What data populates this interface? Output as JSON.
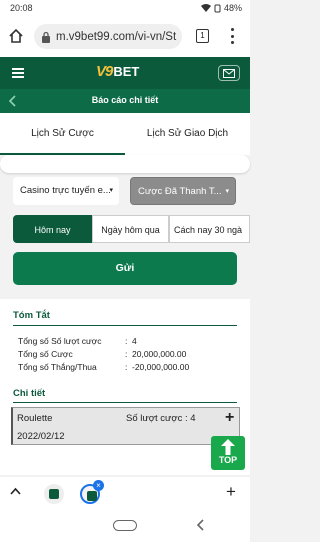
{
  "status": {
    "time": "20:08",
    "battery": "48%"
  },
  "browser": {
    "url": "m.v9bet99.com/vi-vn/St",
    "tab_count": "1"
  },
  "app": {
    "logo_v9": "V9",
    "logo_bet": "BET",
    "page_title": "Báo cáo chi tiết"
  },
  "tabs": [
    {
      "label": "Lịch Sử Cược"
    },
    {
      "label": "Lịch Sử Giao Dịch"
    }
  ],
  "filters": {
    "product": "Casino trực tuyến e...",
    "status": "Cược Đã Thanh T..."
  },
  "periods": [
    {
      "label": "Hôm nay"
    },
    {
      "label": "Ngày hôm qua"
    },
    {
      "label": "Cách nay 30 ngà"
    }
  ],
  "submit_label": "Gửi",
  "summary": {
    "title": "Tóm Tắt",
    "rows": [
      {
        "label": "Tổng số Số lượt cược",
        "value": "4"
      },
      {
        "label": "Tổng số Cược",
        "value": "20,000,000.00"
      },
      {
        "label": "Tổng số Thắng/Thua",
        "value": "-20,000,000.00"
      }
    ]
  },
  "detail": {
    "title": "Chi tiết",
    "item": {
      "game": "Roulette",
      "count": "Số lượt cược : 4",
      "date": "2022/02/12"
    }
  },
  "back_to_top": "TOP",
  "colors": {
    "brand_dark": "#0b5a3c",
    "brand": "#0d7a4e",
    "top_button": "#1aa84c",
    "logo_gold": "#f2c13c"
  }
}
